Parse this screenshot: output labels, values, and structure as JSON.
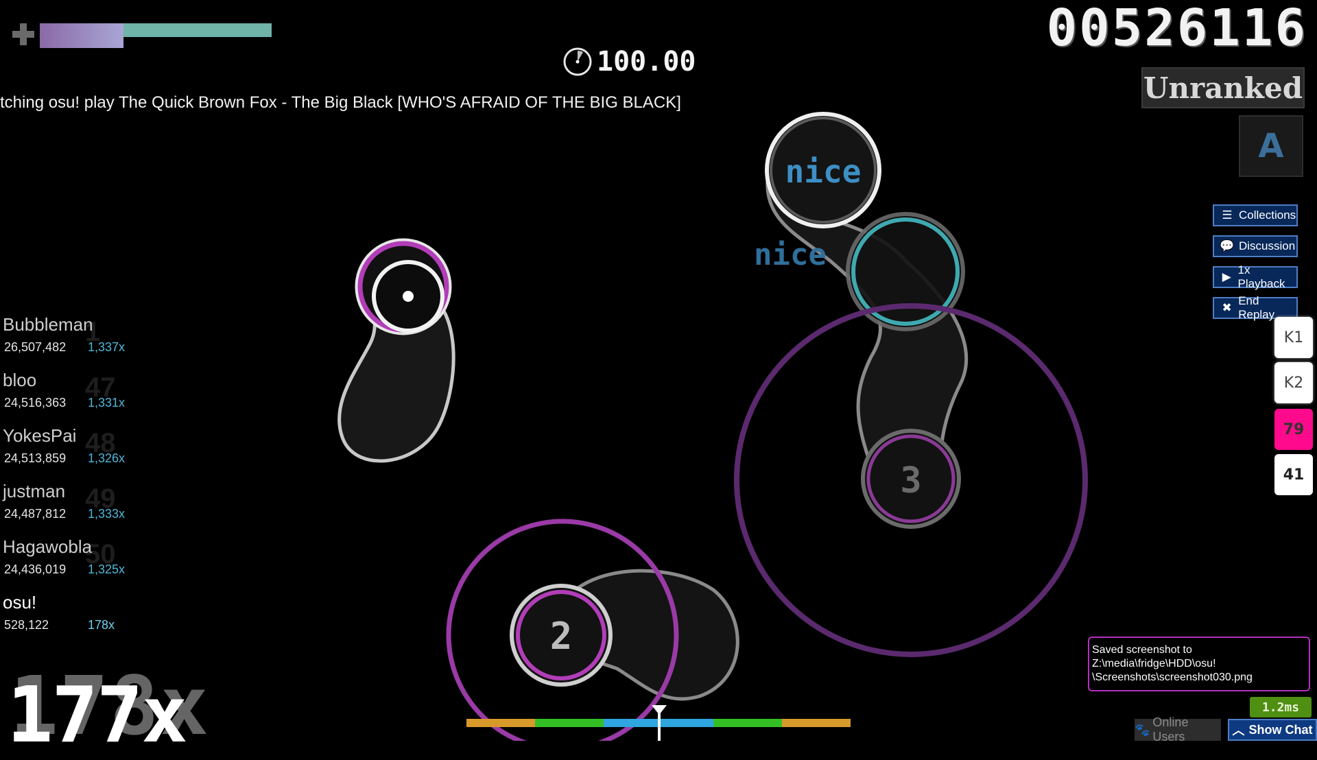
{
  "hud": {
    "health_fraction": 0.36,
    "score": "00526116",
    "accuracy": "100.00",
    "rank_status": "Unranked",
    "grade_letter": "A",
    "combo": "177x",
    "combo_ghost": "178x"
  },
  "watching_text": "tching osu! play The Quick Brown Fox - The Big Black [WHO'S AFRAID OF THE BIG BLACK]",
  "replay_buttons": [
    {
      "label": "Collections",
      "icon": "list-icon"
    },
    {
      "label": "Discussion",
      "icon": "chat-bubble-icon"
    },
    {
      "label": "1x Playback",
      "icon": "play-icon"
    },
    {
      "label": "End Replay",
      "icon": "close-icon"
    }
  ],
  "keys": [
    {
      "label": "K1",
      "state": "off"
    },
    {
      "label": "K2",
      "state": "off"
    },
    {
      "label": "79",
      "state": "on"
    },
    {
      "label": "41",
      "state": "num"
    }
  ],
  "leaderboard": [
    {
      "name": "Bubbleman",
      "rank": "1",
      "score": "26,507,482",
      "combo": "1,337x"
    },
    {
      "name": "bloo",
      "rank": "47",
      "score": "24,516,363",
      "combo": "1,331x"
    },
    {
      "name": "YokesPai",
      "rank": "48",
      "score": "24,513,859",
      "combo": "1,326x"
    },
    {
      "name": "justman",
      "rank": "49",
      "score": "24,487,812",
      "combo": "1,333x"
    },
    {
      "name": "Hagawobla",
      "rank": "50",
      "score": "24,436,019",
      "combo": "1,325x"
    },
    {
      "name": "osu!",
      "rank": "",
      "score": "528,122",
      "combo": "178x"
    }
  ],
  "playfield": {
    "hit_texts": [
      "nice",
      "nice"
    ],
    "circle_numbers": [
      "2",
      "3"
    ],
    "colors": {
      "combo_purple": "#b23db8",
      "combo_cyan": "#3fa9b0",
      "slider_border": "#d0d0d0"
    }
  },
  "hit_error_colors": [
    "#d89a2b",
    "#34c025",
    "#2fa6e0"
  ],
  "notification": {
    "line1": "Saved screenshot to",
    "line2": "Z:\\media\\fridge\\HDD\\osu!",
    "line3": "\\Screenshots\\screenshot030.png"
  },
  "ping": "1.2ms",
  "bottom_buttons": {
    "online_users": "Online Users",
    "show_chat": "Show Chat"
  }
}
